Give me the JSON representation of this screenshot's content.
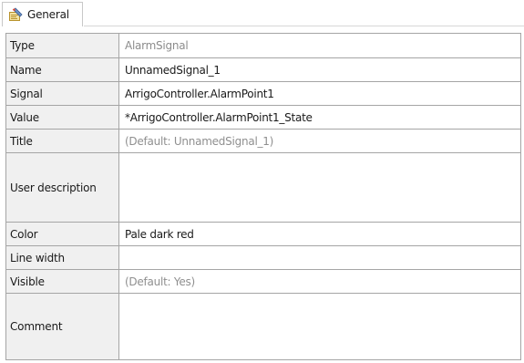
{
  "tab": {
    "label": "General",
    "icon": "properties-icon"
  },
  "properties": [
    {
      "key": "type",
      "label": "Type",
      "value": "AlarmSignal",
      "style": "readonly"
    },
    {
      "key": "name",
      "label": "Name",
      "value": "UnnamedSignal_1",
      "style": "normal"
    },
    {
      "key": "signal",
      "label": "Signal",
      "value": "ArrigoController.AlarmPoint1",
      "style": "normal"
    },
    {
      "key": "value",
      "label": "Value",
      "value": "*ArrigoController.AlarmPoint1_State",
      "style": "normal"
    },
    {
      "key": "title",
      "label": "Title",
      "value": "(Default: UnnamedSignal_1)",
      "style": "default"
    },
    {
      "key": "user-description",
      "label": "User description",
      "value": "",
      "style": "normal"
    },
    {
      "key": "color",
      "label": "Color",
      "value": "Pale dark red",
      "style": "normal"
    },
    {
      "key": "line-width",
      "label": "Line width",
      "value": "",
      "style": "normal"
    },
    {
      "key": "visible",
      "label": "Visible",
      "value": "(Default: Yes)",
      "style": "default"
    },
    {
      "key": "comment",
      "label": "Comment",
      "value": "",
      "style": "normal"
    }
  ],
  "colors": {
    "label_bg": "#f0f0f0",
    "grid_line": "#a5a5a5",
    "readonly_text": "#8c8c8c"
  }
}
